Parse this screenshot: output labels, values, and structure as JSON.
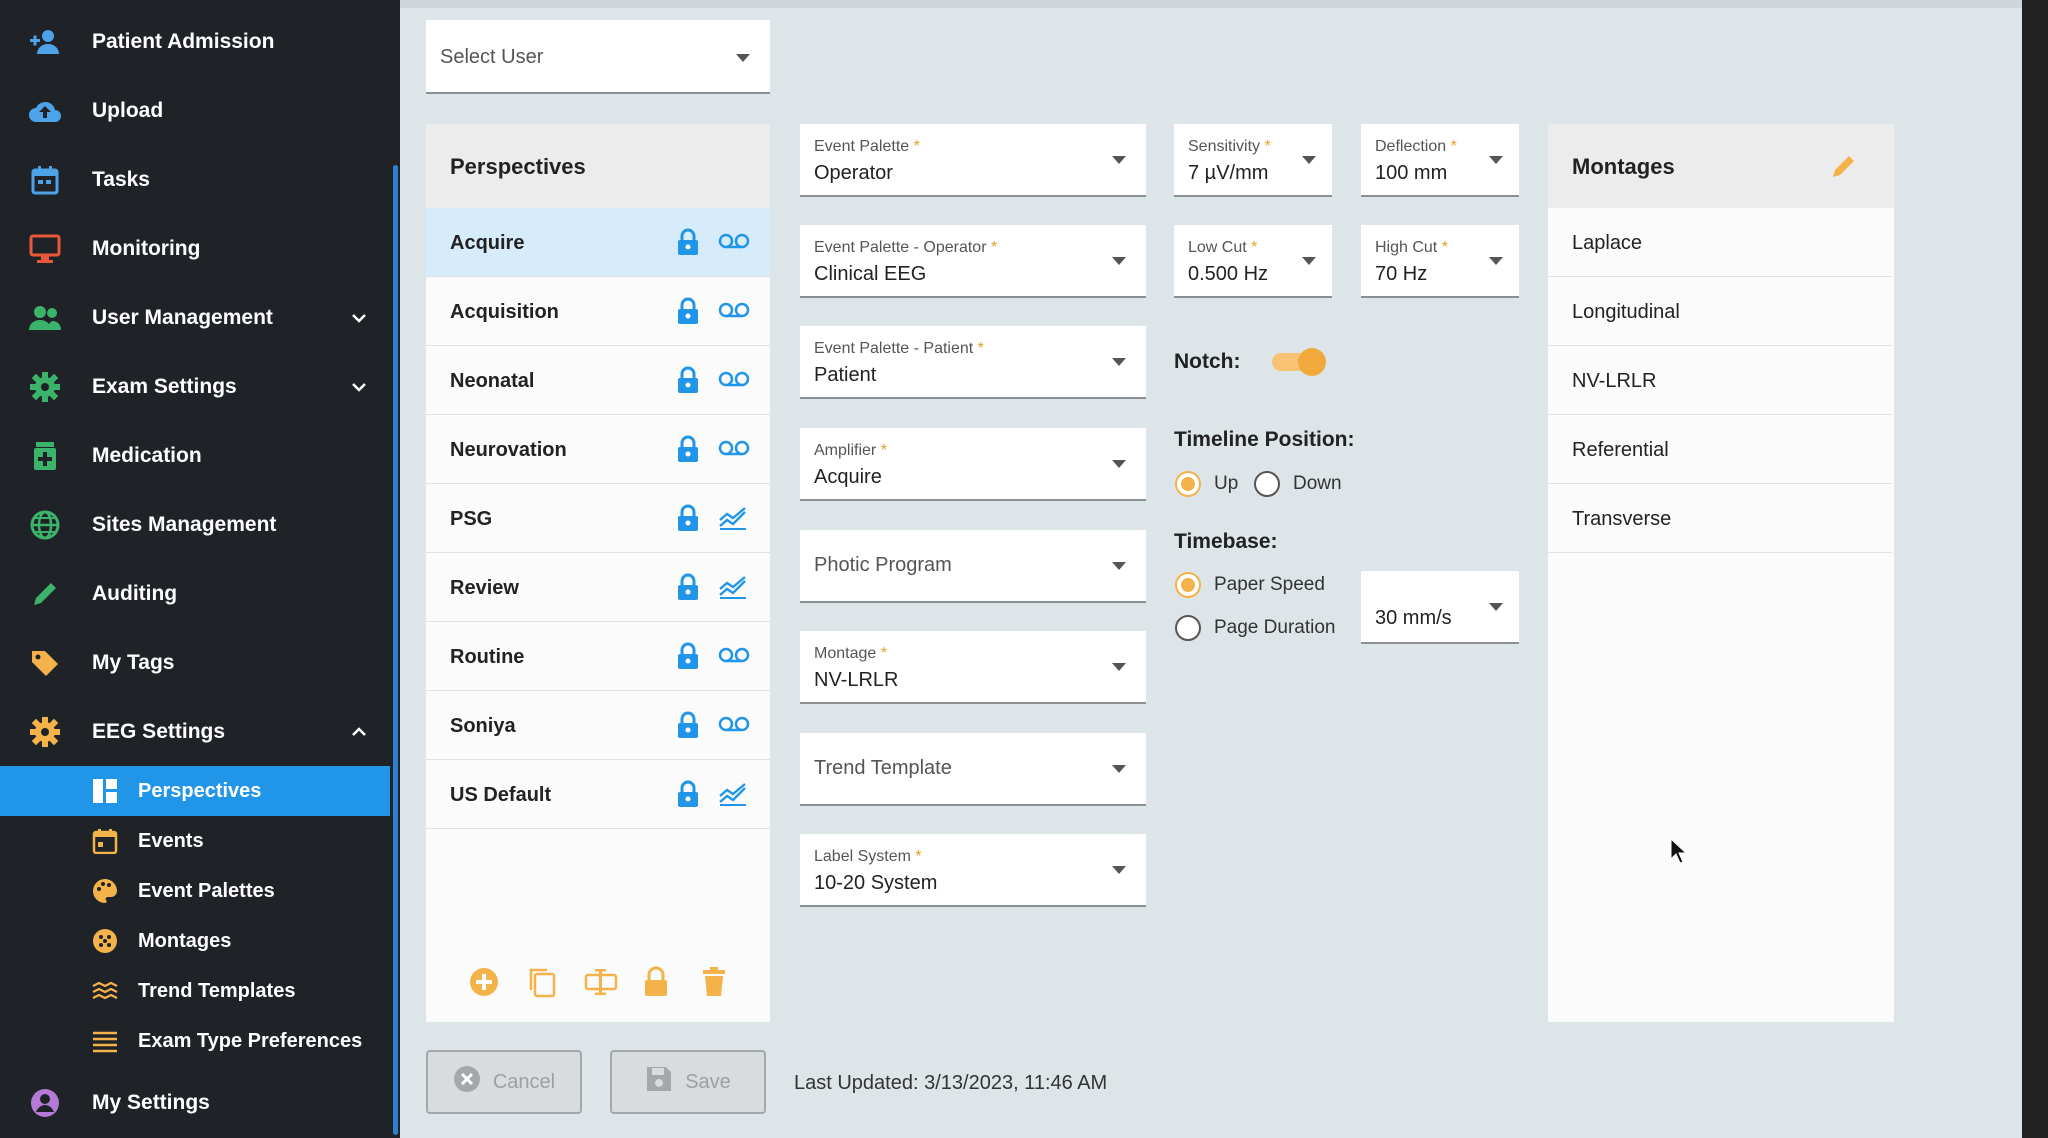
{
  "sidebar": {
    "items": [
      {
        "label": "Patient Admission",
        "icon": "person-add-icon"
      },
      {
        "label": "Upload",
        "icon": "cloud-upload-icon"
      },
      {
        "label": "Tasks",
        "icon": "calendar-icon"
      },
      {
        "label": "Monitoring",
        "icon": "monitor-icon"
      },
      {
        "label": "User Management",
        "icon": "group-icon"
      },
      {
        "label": "Exam Settings",
        "icon": "gear-icon"
      },
      {
        "label": "Medication",
        "icon": "medication-icon"
      },
      {
        "label": "Sites Management",
        "icon": "globe-icon"
      },
      {
        "label": "Auditing",
        "icon": "pencil-icon"
      },
      {
        "label": "My Tags",
        "icon": "tag-icon"
      },
      {
        "label": "EEG Settings",
        "icon": "gear-icon"
      },
      {
        "label": "My Settings",
        "icon": "account-circle-icon"
      }
    ],
    "subitems": [
      {
        "label": "Perspectives",
        "icon": "dashboard-icon",
        "active": true
      },
      {
        "label": "Events",
        "icon": "calendar-icon"
      },
      {
        "label": "Event Palettes",
        "icon": "palette-icon"
      },
      {
        "label": "Montages",
        "icon": "montage-icon"
      },
      {
        "label": "Trend Templates",
        "icon": "trend-icon"
      },
      {
        "label": "Exam Type Preferences",
        "icon": "lines-icon"
      }
    ]
  },
  "select_user": {
    "placeholder": "Select User"
  },
  "perspectives": {
    "title": "Perspectives",
    "rows": [
      {
        "name": "Acquire",
        "type": "acquire-icon",
        "selected": true
      },
      {
        "name": "Acquisition",
        "type": "acquire-icon"
      },
      {
        "name": "Neonatal",
        "type": "acquire-icon"
      },
      {
        "name": "Neurovation",
        "type": "acquire-icon"
      },
      {
        "name": "PSG",
        "type": "review-icon"
      },
      {
        "name": "Review",
        "type": "review-icon"
      },
      {
        "name": "Routine",
        "type": "acquire-icon"
      },
      {
        "name": "Soniya",
        "type": "acquire-icon"
      },
      {
        "name": "US Default",
        "type": "review-icon"
      }
    ]
  },
  "fields": {
    "event_palette": {
      "label": "Event Palette",
      "value": "Operator"
    },
    "event_palette_operator": {
      "label": "Event Palette - Operator",
      "value": "Clinical EEG"
    },
    "event_palette_patient": {
      "label": "Event Palette - Patient",
      "value": "Patient"
    },
    "amplifier": {
      "label": "Amplifier",
      "value": "Acquire"
    },
    "photic_program": {
      "placeholder": "Photic Program"
    },
    "montage": {
      "label": "Montage",
      "value": "NV-LRLR"
    },
    "trend_template": {
      "placeholder": "Trend Template"
    },
    "label_system": {
      "label": "Label System",
      "value": "10-20 System"
    },
    "sensitivity": {
      "label": "Sensitivity",
      "value": "7 µV/mm"
    },
    "deflection": {
      "label": "Deflection",
      "value": "100 mm"
    },
    "low_cut": {
      "label": "Low Cut",
      "value": "0.500 Hz"
    },
    "high_cut": {
      "label": "High Cut",
      "value": "70 Hz"
    },
    "paper_speed_value": "30 mm/s"
  },
  "notch": {
    "label": "Notch:",
    "on": true
  },
  "timeline": {
    "label": "Timeline Position:",
    "up": "Up",
    "down": "Down",
    "selected": "Up"
  },
  "timebase": {
    "label": "Timebase:",
    "paper_speed": "Paper Speed",
    "page_duration": "Page Duration",
    "selected": "Paper Speed"
  },
  "montages": {
    "title": "Montages",
    "rows": [
      "Laplace",
      "Longitudinal",
      "NV-LRLR",
      "Referential",
      "Transverse"
    ]
  },
  "buttons": {
    "cancel": "Cancel",
    "save": "Save"
  },
  "last_updated": "Last Updated: 3/13/2023, 11:46 AM",
  "colors": {
    "accent": "#2196e8",
    "orange": "#f4b24a",
    "sidebar_bg": "#1f2226"
  }
}
